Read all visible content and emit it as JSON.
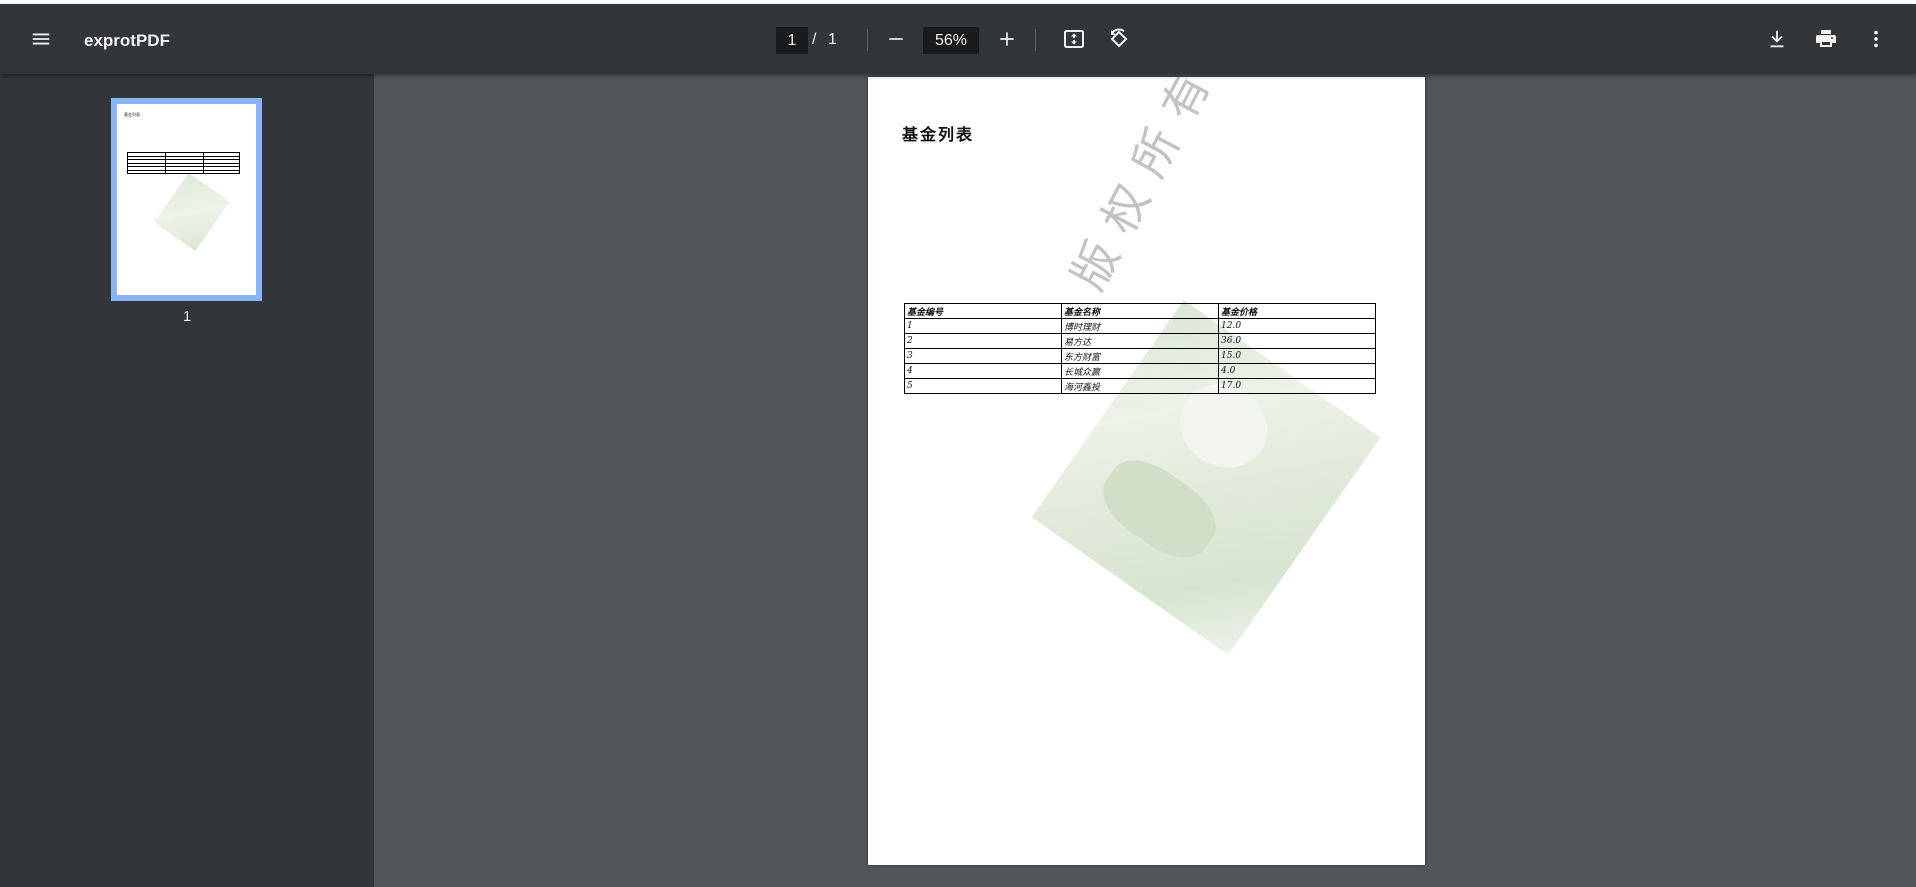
{
  "toolbar": {
    "title": "exprotPDF",
    "current_page": "1",
    "separator": "/",
    "total_pages": "1",
    "zoom": "56%"
  },
  "icons": {
    "menu": "menu-icon",
    "zoom_out": "minus-icon",
    "zoom_in": "plus-icon",
    "fit": "fit-page-icon",
    "rotate": "rotate-icon",
    "download": "download-icon",
    "print": "print-icon",
    "more": "more-vert-icon"
  },
  "sidebar": {
    "thumbnails": [
      {
        "label": "1",
        "selected": true
      }
    ]
  },
  "document": {
    "heading": "基金列表",
    "watermark_text": "版权所有",
    "table": {
      "headers": [
        "基金编号",
        "基金名称",
        "基金价格"
      ],
      "rows": [
        [
          "1",
          "博时理财",
          "12.0"
        ],
        [
          "2",
          "易方达",
          "36.0"
        ],
        [
          "3",
          "东方财富",
          "15.0"
        ],
        [
          "4",
          "长城众赢",
          "4.0"
        ],
        [
          "5",
          "海河鑫投",
          "17.0"
        ]
      ]
    }
  },
  "colors": {
    "toolbar_bg": "#323639",
    "viewer_bg": "#525659",
    "thumb_border": "#8ab4f8"
  }
}
